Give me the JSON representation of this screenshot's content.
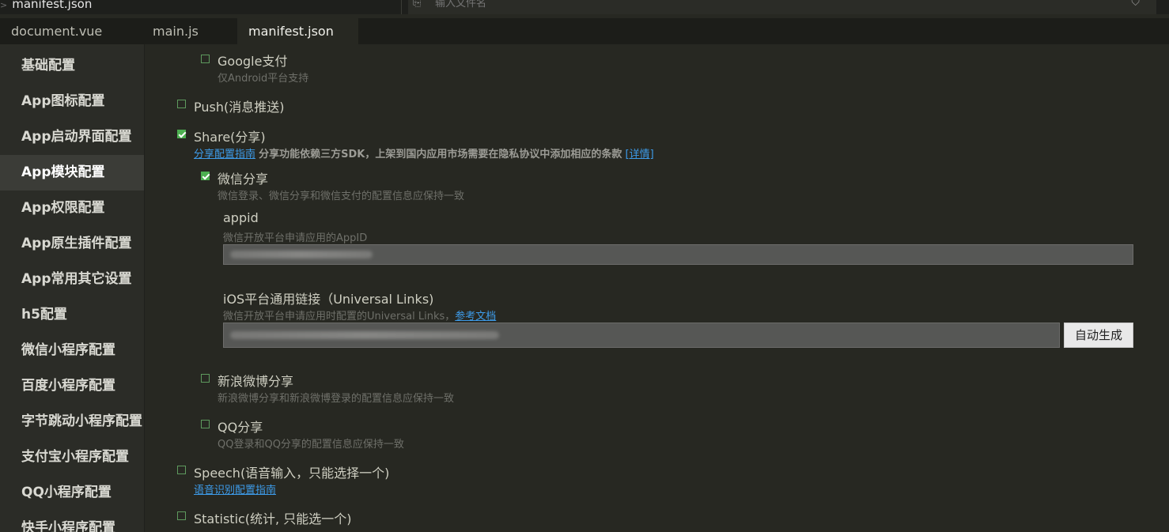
{
  "breadcrumb": {
    "file": "manifest.json"
  },
  "file_filter": {
    "placeholder": "输入文件名"
  },
  "tabs": [
    {
      "label": "document.vue",
      "active": false
    },
    {
      "label": "main.js",
      "active": false
    },
    {
      "label": "manifest.json",
      "active": true
    }
  ],
  "sidebar": {
    "items": [
      {
        "label": "基础配置"
      },
      {
        "label": "App图标配置"
      },
      {
        "label": "App启动界面配置"
      },
      {
        "label": "App模块配置",
        "active": true
      },
      {
        "label": "App权限配置"
      },
      {
        "label": "App原生插件配置"
      },
      {
        "label": "App常用其它设置"
      },
      {
        "label": "h5配置"
      },
      {
        "label": "微信小程序配置"
      },
      {
        "label": "百度小程序配置"
      },
      {
        "label": "字节跳动小程序配置"
      },
      {
        "label": "支付宝小程序配置"
      },
      {
        "label": "QQ小程序配置"
      },
      {
        "label": "快手小程序配置"
      }
    ]
  },
  "modules": {
    "google_pay": {
      "label": "Google支付",
      "checked": false,
      "desc": "仅Android平台支持"
    },
    "push": {
      "label": "Push(消息推送)",
      "checked": false
    },
    "share": {
      "label": "Share(分享)",
      "checked": true,
      "guide_link": "分享配置指南",
      "notice": "分享功能依赖三方SDK，上架到国内应用市场需要在隐私协议中添加相应的条款",
      "details_link": "[详情]"
    },
    "weixin_share": {
      "label": "微信分享",
      "checked": true,
      "desc": "微信登录、微信分享和微信支付的配置信息应保持一致",
      "appid_label": "appid",
      "appid_desc": "微信开放平台申请应用的AppID",
      "ulink_label": "iOS平台通用链接（Universal Links)",
      "ulink_desc": "微信开放平台申请应用时配置的Universal Links，",
      "ulink_ref_link": "参考文档",
      "auto_button": "自动生成"
    },
    "sina_share": {
      "label": "新浪微博分享",
      "checked": false,
      "desc": "新浪微博分享和新浪微博登录的配置信息应保持一致"
    },
    "qq_share": {
      "label": "QQ分享",
      "checked": false,
      "desc": "QQ登录和QQ分享的配置信息应保持一致"
    },
    "speech": {
      "label": "Speech(语音输入，只能选择一个)",
      "checked": false,
      "guide_link": "语音识别配置指南"
    },
    "statistic": {
      "label": "Statistic(统计, 只能选一个)",
      "checked": false
    }
  },
  "colors": {
    "accent_link": "#3d9be9",
    "checkbox_checked": "#4caf50",
    "background": "#272822"
  }
}
